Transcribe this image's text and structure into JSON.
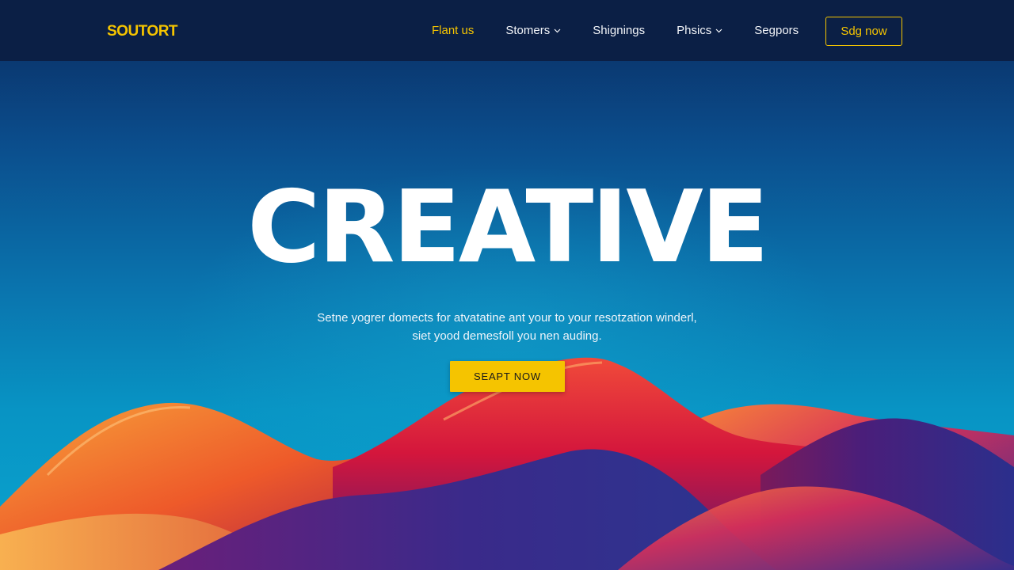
{
  "brand": {
    "logo_text": "SOUTORT",
    "accent_color": "#f5c400"
  },
  "nav": {
    "items": [
      {
        "label": "Flant us",
        "active": true,
        "has_dropdown": false
      },
      {
        "label": "Stomers",
        "active": false,
        "has_dropdown": true,
        "icon": "chevron-down-icon"
      },
      {
        "label": "Shignings",
        "active": false,
        "has_dropdown": false
      },
      {
        "label": "Phsics",
        "active": false,
        "has_dropdown": true,
        "icon": "chevron-down-icon"
      },
      {
        "label": "Segpors",
        "active": false,
        "has_dropdown": false
      }
    ],
    "signup_label": "Sdg now"
  },
  "hero": {
    "title": "CREATIVE",
    "subtitle_line1": "Setne yogrer domects for atvatatine ant your to your resotzation winderl,",
    "subtitle_line2": "siet yood demesfoll you nen auding.",
    "cta_label": "SEAPT NOW"
  },
  "colors": {
    "nav_background": "#0b1f45",
    "hero_top": "#0a2a5e",
    "hero_bottom": "#0aa4cf"
  }
}
